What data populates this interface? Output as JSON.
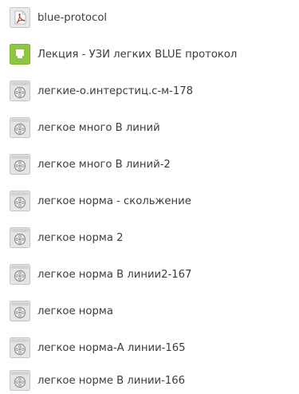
{
  "files": [
    {
      "name": "blue-protocol",
      "icon": "pdf-file-icon",
      "accent": "#c0392b"
    },
    {
      "name": "Лекция - УЗИ легких BLUE протокол",
      "icon": "presentation-file-icon",
      "accent": "#8dc63f"
    },
    {
      "name": "легкие-о.интерстиц.с-м-178",
      "icon": "video-file-icon"
    },
    {
      "name": "легкое много В линий",
      "icon": "video-file-icon"
    },
    {
      "name": "легкое много В линий-2",
      "icon": "video-file-icon"
    },
    {
      "name": "легкое норма - скольжение",
      "icon": "video-file-icon"
    },
    {
      "name": "легкое норма 2",
      "icon": "video-file-icon"
    },
    {
      "name": "легкое норма В линии2-167",
      "icon": "video-file-icon"
    },
    {
      "name": "легкое норма",
      "icon": "video-file-icon"
    },
    {
      "name": "легкое норма-А линии-165",
      "icon": "video-file-icon"
    },
    {
      "name": "легкое норме В линии-166",
      "icon": "video-file-icon"
    }
  ]
}
